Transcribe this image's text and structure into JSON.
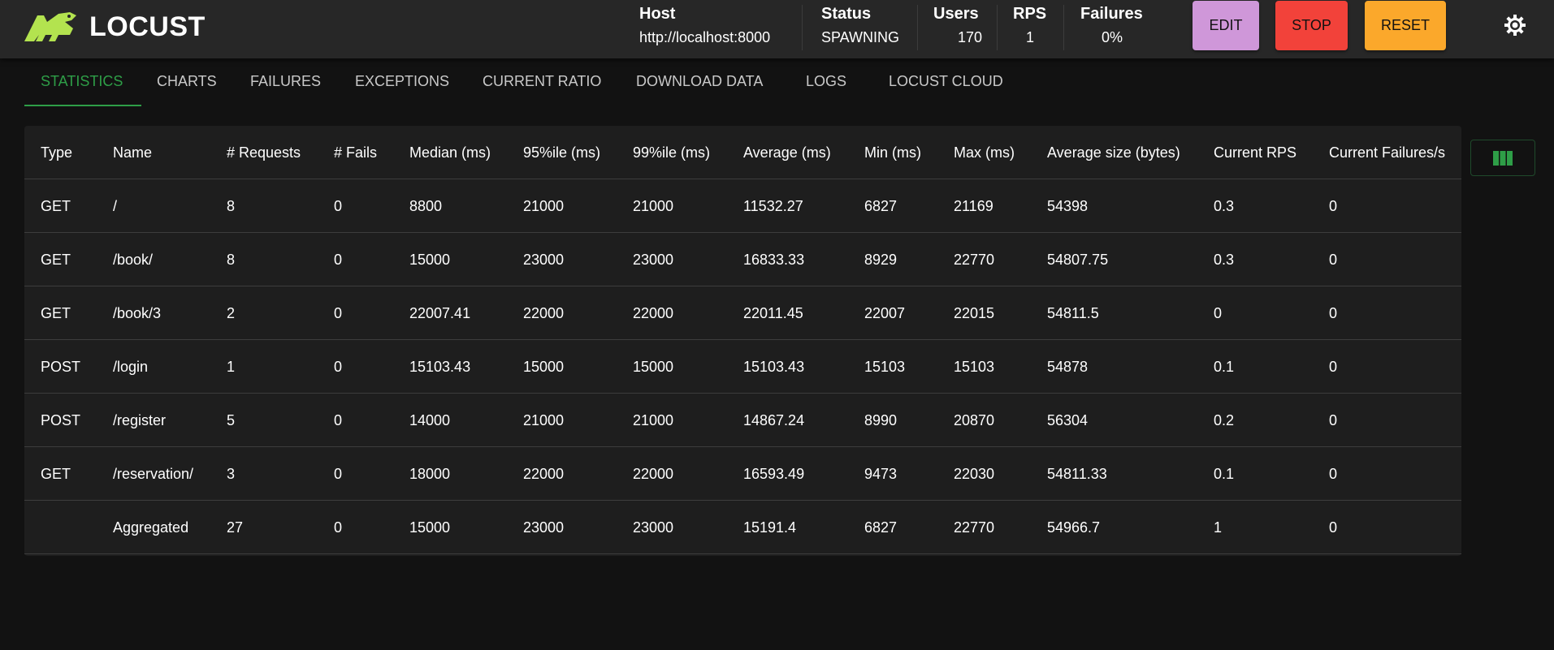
{
  "app": {
    "name": "LOCUST"
  },
  "header": {
    "stats": [
      {
        "label": "Host",
        "value": "http://localhost:8000"
      },
      {
        "label": "Status",
        "value": "SPAWNING"
      },
      {
        "label": "Users",
        "value": "170"
      },
      {
        "label": "RPS",
        "value": "1"
      },
      {
        "label": "Failures",
        "value": "0%"
      }
    ],
    "buttons": {
      "edit": "EDIT",
      "stop": "STOP",
      "reset": "RESET"
    }
  },
  "tabs": [
    {
      "label": "STATISTICS"
    },
    {
      "label": "CHARTS"
    },
    {
      "label": "FAILURES"
    },
    {
      "label": "EXCEPTIONS"
    },
    {
      "label": "CURRENT RATIO"
    },
    {
      "label": "DOWNLOAD DATA"
    },
    {
      "label": "LOGS"
    },
    {
      "label": "LOCUST CLOUD"
    }
  ],
  "active_tab": "STATISTICS",
  "table": {
    "columns": [
      "Type",
      "Name",
      "# Requests",
      "# Fails",
      "Median (ms)",
      "95%ile (ms)",
      "99%ile (ms)",
      "Average (ms)",
      "Min (ms)",
      "Max (ms)",
      "Average size (bytes)",
      "Current RPS",
      "Current Failures/s"
    ],
    "rows": [
      [
        "GET",
        "/",
        "8",
        "0",
        "8800",
        "21000",
        "21000",
        "11532.27",
        "6827",
        "21169",
        "54398",
        "0.3",
        "0"
      ],
      [
        "GET",
        "/book/",
        "8",
        "0",
        "15000",
        "23000",
        "23000",
        "16833.33",
        "8929",
        "22770",
        "54807.75",
        "0.3",
        "0"
      ],
      [
        "GET",
        "/book/3",
        "2",
        "0",
        "22007.41",
        "22000",
        "22000",
        "22011.45",
        "22007",
        "22015",
        "54811.5",
        "0",
        "0"
      ],
      [
        "POST",
        "/login",
        "1",
        "0",
        "15103.43",
        "15000",
        "15000",
        "15103.43",
        "15103",
        "15103",
        "54878",
        "0.1",
        "0"
      ],
      [
        "POST",
        "/register",
        "5",
        "0",
        "14000",
        "21000",
        "21000",
        "14867.24",
        "8990",
        "20870",
        "56304",
        "0.2",
        "0"
      ],
      [
        "GET",
        "/reservation/",
        "3",
        "0",
        "18000",
        "22000",
        "22000",
        "16593.49",
        "9473",
        "22030",
        "54811.33",
        "0.1",
        "0"
      ],
      [
        "",
        "Aggregated",
        "27",
        "0",
        "15000",
        "23000",
        "23000",
        "15191.4",
        "6827",
        "22770",
        "54966.7",
        "1",
        "0"
      ]
    ]
  },
  "colors": {
    "accent": "#2e9e47",
    "edit": "#cf97d9",
    "stop": "#f2423a",
    "reset": "#fba82b",
    "logo": "#b3e34f"
  }
}
